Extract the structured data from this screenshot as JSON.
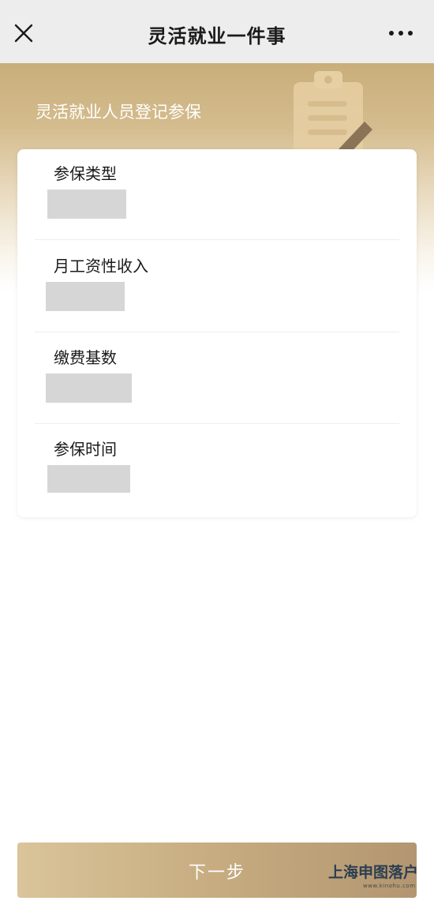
{
  "navbar": {
    "title": "灵活就业一件事",
    "close_icon": "close-icon",
    "more_icon": "more-icon"
  },
  "banner": {
    "title": "灵活就业人员登记参保",
    "icon": "clipboard-pencil-icon"
  },
  "form": {
    "fields": [
      {
        "label": "参保类型",
        "value": ""
      },
      {
        "label": "月工资性收入",
        "value": ""
      },
      {
        "label": "缴费基数",
        "value": ""
      },
      {
        "label": "参保时间",
        "value": ""
      }
    ]
  },
  "footer": {
    "next_label": "下一步"
  },
  "watermark": {
    "text": "上海申图落户",
    "url": "www.kinohu.com"
  },
  "colors": {
    "accent": "#c8ae82",
    "navbar_bg": "#ededed",
    "placeholder_gray": "#d6d6d6"
  }
}
